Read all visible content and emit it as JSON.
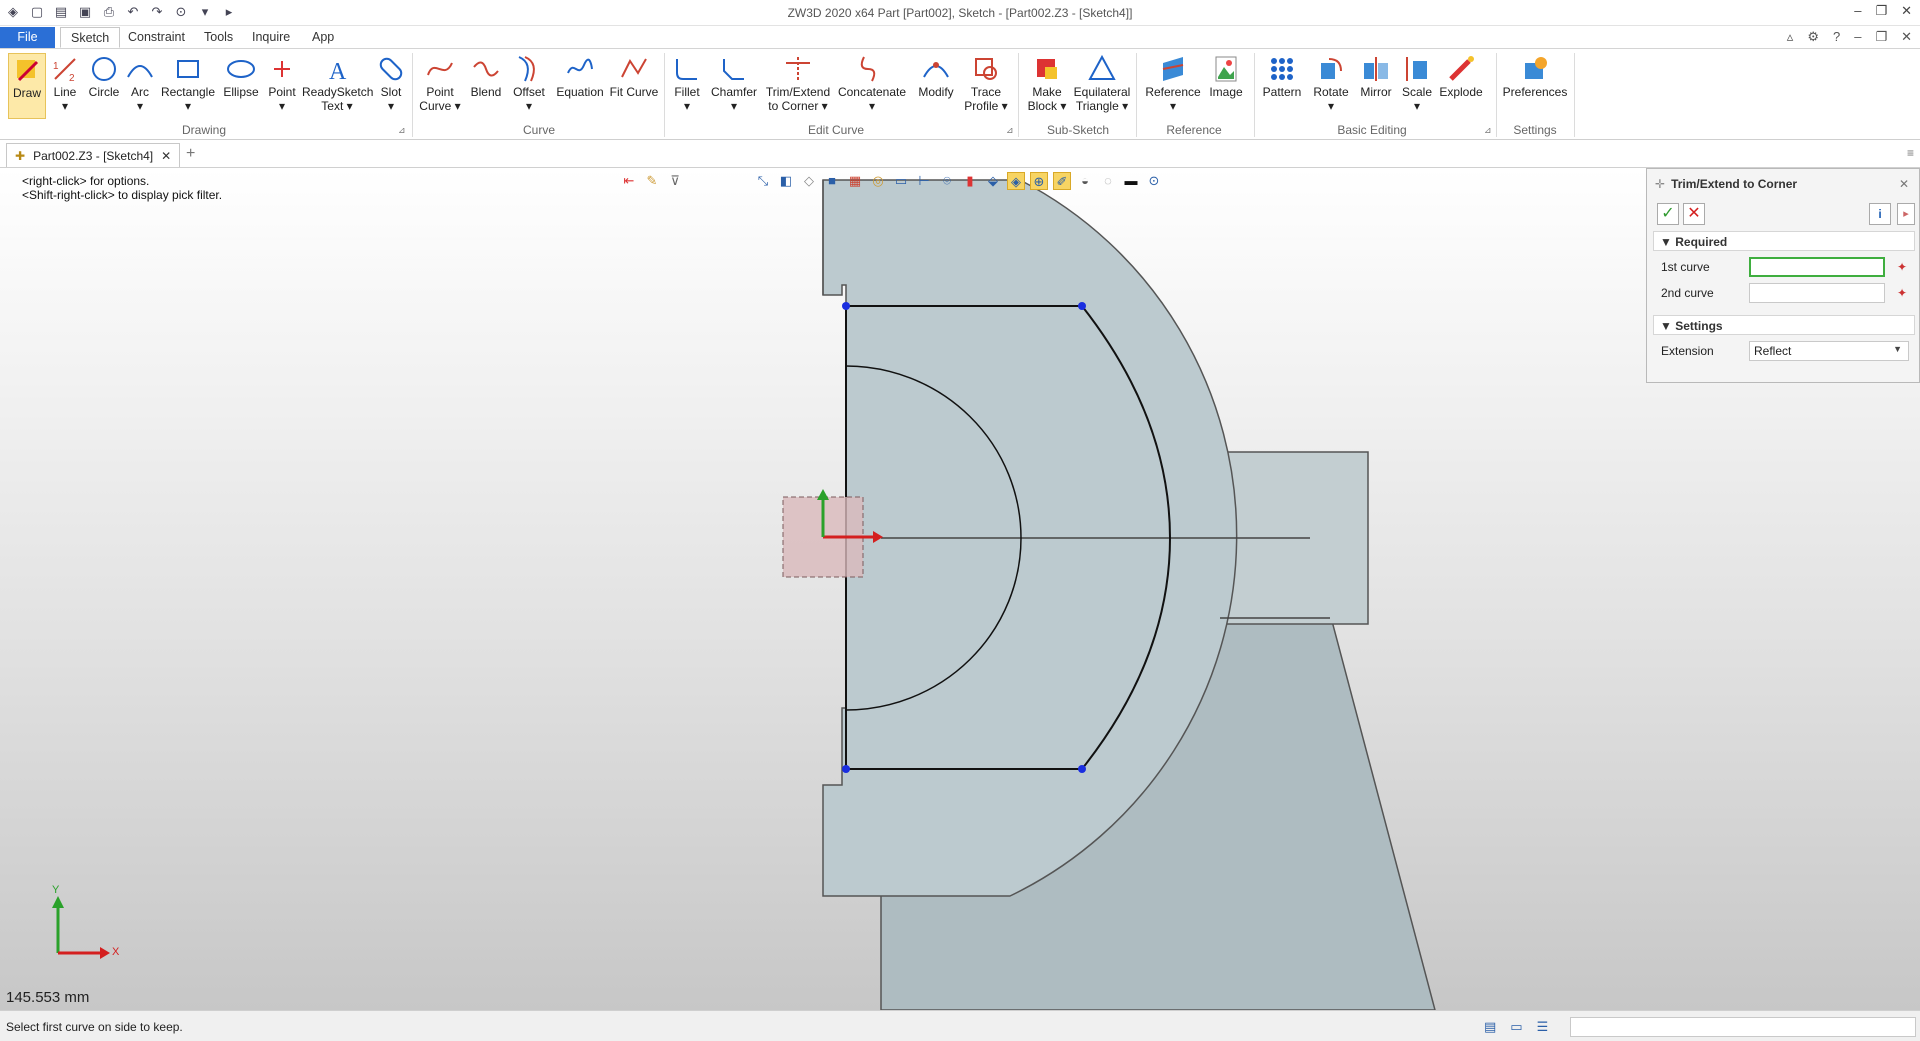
{
  "window": {
    "title": "ZW3D 2020 x64        Part [Part002],  Sketch - [Part002.Z3 - [Sketch4]]"
  },
  "menu": {
    "tabs": [
      "File",
      "Sketch",
      "Constraint",
      "Tools",
      "Inquire",
      "App"
    ],
    "active": "Sketch"
  },
  "ribbon": {
    "buttons": {
      "draw": "Draw",
      "line": "Line",
      "circle": "Circle",
      "arc": "Arc",
      "rectangle": "Rectangle",
      "ellipse": "Ellipse",
      "point": "Point",
      "readysketch_1": "ReadySketch",
      "readysketch_2": "Text",
      "slot": "Slot",
      "point_curve_1": "Point",
      "point_curve_2": "Curve",
      "blend": "Blend",
      "offset": "Offset",
      "equation": "Equation",
      "fit_curve": "Fit Curve",
      "fillet": "Fillet",
      "chamfer": "Chamfer",
      "trim_extend_1": "Trim/Extend",
      "trim_extend_2": "to Corner",
      "concatenate": "Concatenate",
      "modify": "Modify",
      "trace_profile_1": "Trace",
      "trace_profile_2": "Profile",
      "make_block_1": "Make",
      "make_block_2": "Block",
      "equilateral_1": "Equilateral",
      "equilateral_2": "Triangle",
      "reference": "Reference",
      "image": "Image",
      "pattern": "Pattern",
      "rotate": "Rotate",
      "mirror": "Mirror",
      "scale": "Scale",
      "explode": "Explode",
      "preferences": "Preferences"
    },
    "groups": {
      "drawing": "Drawing",
      "curve": "Curve",
      "edit_curve": "Edit Curve",
      "sub_sketch": "Sub-Sketch",
      "reference": "Reference",
      "basic_editing": "Basic Editing",
      "settings": "Settings"
    }
  },
  "document_tab": {
    "label": "Part002.Z3 - [Sketch4]"
  },
  "viewport": {
    "hint_1": "<right-click> for options.",
    "hint_2": "<Shift-right-click> to display pick filter.",
    "scale_readout": "145.553 mm",
    "axis_x": "X",
    "axis_y": "Y"
  },
  "panel": {
    "title": "Trim/Extend to Corner",
    "required_section": "Required",
    "first_curve_label": "1st curve",
    "first_curve_value": "",
    "second_curve_label": "2nd curve",
    "second_curve_value": "",
    "settings_section": "Settings",
    "extension_label": "Extension",
    "extension_value": "Reflect"
  },
  "status": {
    "message": "Select first curve on side to keep."
  },
  "colors": {
    "file_tab": "#2b6fd6",
    "part_fill": "#b9c8cc",
    "sketch_point": "#1a2ee0",
    "ok_green": "#2f9a2f",
    "cancel_red": "#d42020"
  }
}
